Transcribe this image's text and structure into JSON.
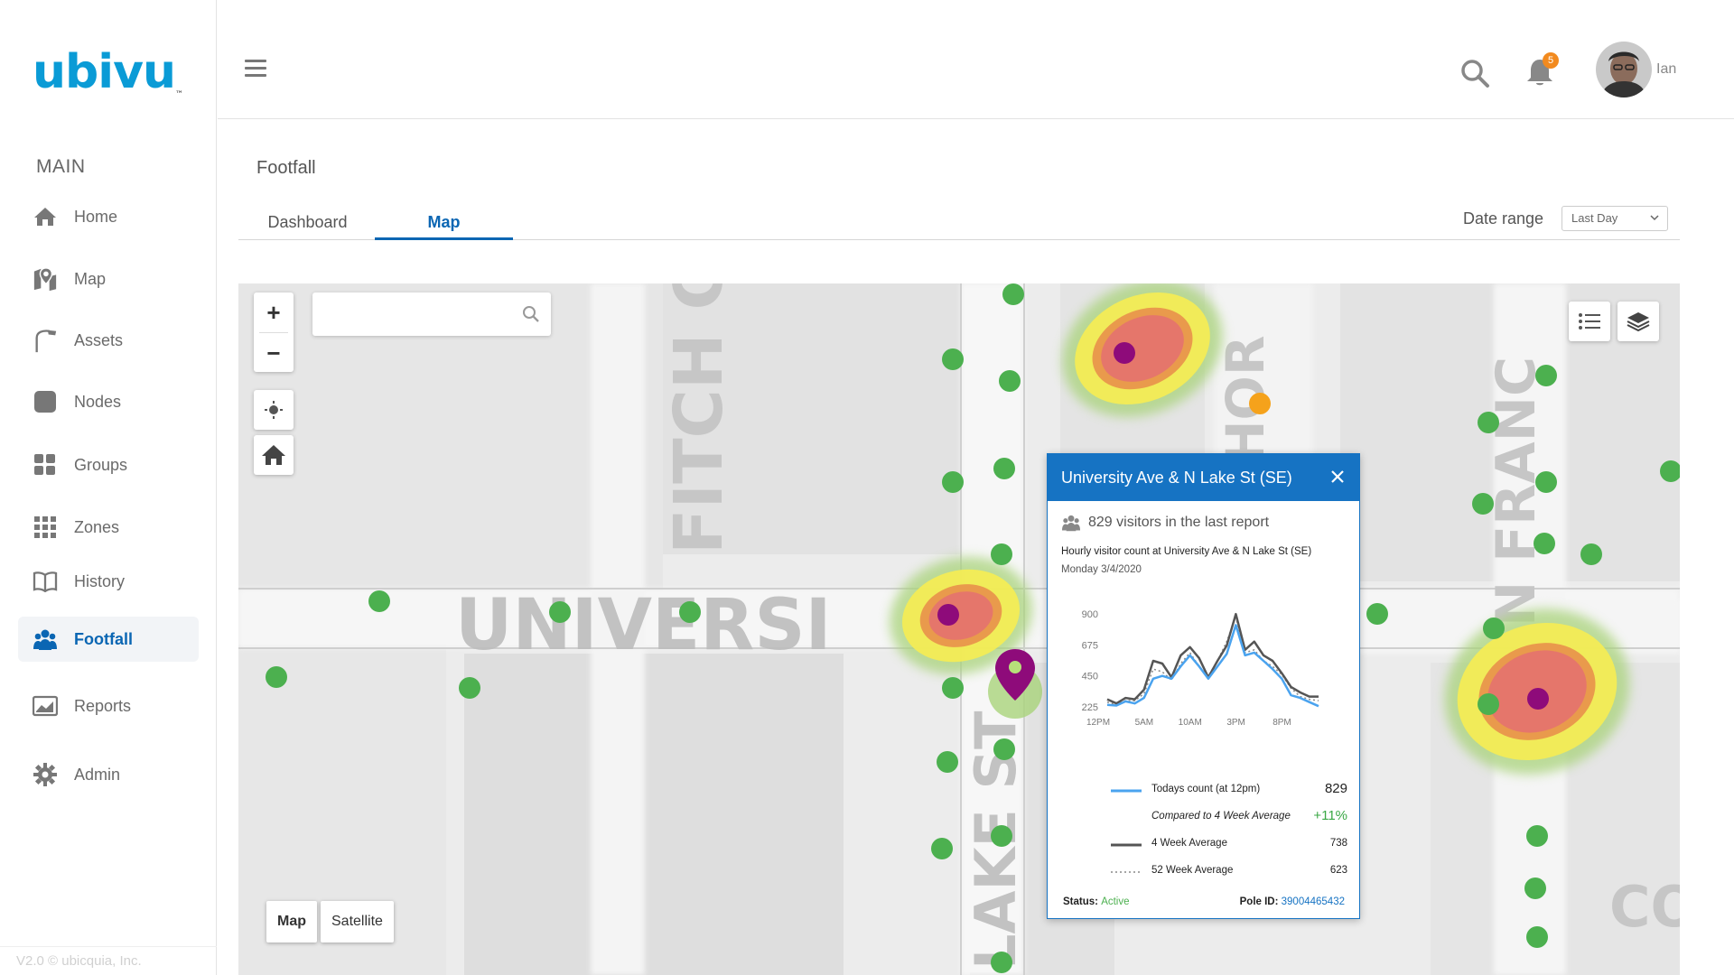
{
  "app": {
    "logo_text": "ubivu",
    "logo_tm": "™",
    "version": "V2.0 © ubicquia, Inc."
  },
  "sidebar": {
    "section_label": "MAIN",
    "items": [
      {
        "label": "Home",
        "icon": "home-icon"
      },
      {
        "label": "Map",
        "icon": "map-pin-icon"
      },
      {
        "label": "Assets",
        "icon": "streetlight-icon"
      },
      {
        "label": "Nodes",
        "icon": "node-icon"
      },
      {
        "label": "Groups",
        "icon": "groups-icon"
      },
      {
        "label": "Zones",
        "icon": "zones-icon"
      },
      {
        "label": "History",
        "icon": "book-icon"
      },
      {
        "label": "Footfall",
        "icon": "people-icon",
        "active": true
      },
      {
        "label": "Reports",
        "icon": "reports-icon"
      },
      {
        "label": "Admin",
        "icon": "gear-icon"
      }
    ]
  },
  "header": {
    "notification_count": "5",
    "user_name": "Ian"
  },
  "page": {
    "title": "Footfall",
    "tabs": [
      {
        "label": "Dashboard",
        "active": false
      },
      {
        "label": "Map",
        "active": true
      }
    ],
    "date_range_label": "Date range",
    "date_range_value": "Last Day"
  },
  "map": {
    "search_placeholder": "",
    "zoom_in": "+",
    "zoom_out": "−",
    "map_type_options": [
      "Map",
      "Satellite"
    ],
    "map_type_selected": "Map",
    "street_labels": [
      "FITCH C",
      "UNIVERSI",
      "LAKE ST",
      "HOR",
      "N FRANC",
      "CO"
    ]
  },
  "popup": {
    "title": "University Ave & N Lake St (SE)",
    "visitors_text": "829 visitors in the last report",
    "chart_subtitle": "Hourly visitor count at University Ave & N Lake St (SE)",
    "chart_date": "Monday 3/4/2020",
    "legend": [
      {
        "label": "Todays count (at 12pm)",
        "value": "829"
      },
      {
        "label": "Compared to 4 Week Average",
        "value": "+11%"
      },
      {
        "label": "4 Week Average",
        "value": "738"
      },
      {
        "label": "52 Week Average",
        "value": "623"
      }
    ],
    "status_label": "Status:",
    "status_value": "Active",
    "pole_label": "Pole ID:",
    "pole_value": "39004465432"
  },
  "colors": {
    "brand": "#0a9bd6",
    "accent": "#0b66b3",
    "popup_header": "#1673c3",
    "node_green": "#4cb04f",
    "node_orange": "#f5a21b",
    "marker_purple": "#8e0b7a",
    "today_series": "#4aa3ef",
    "avg4_series": "#555555",
    "avg52_series": "#888888",
    "positive": "#3aa845"
  },
  "chart_data": {
    "type": "line",
    "title": "Hourly visitor count at University Ave & N Lake St (SE)",
    "subtitle": "Monday 3/4/2020",
    "x_ticks": [
      "12PM",
      "5AM",
      "10AM",
      "3PM",
      "8PM"
    ],
    "y_ticks": [
      225,
      450,
      675,
      900
    ],
    "ylim": [
      225,
      1000
    ],
    "x": [
      "12PM",
      "1AM",
      "2AM",
      "3AM",
      "4AM",
      "5AM",
      "6AM",
      "7AM",
      "8AM",
      "9AM",
      "10AM",
      "11AM",
      "12PM",
      "1PM",
      "2PM",
      "3PM",
      "4PM",
      "5PM",
      "6PM",
      "7PM",
      "8PM",
      "9PM",
      "10PM",
      "11PM"
    ],
    "series": [
      {
        "name": "Todays count (at 12pm)",
        "values": [
          240,
          235,
          265,
          250,
          290,
          430,
          450,
          430,
          520,
          600,
          520,
          430,
          520,
          610,
          820,
          600,
          620,
          560,
          500,
          430,
          310,
          290,
          260,
          230
        ]
      },
      {
        "name": "4 Week Average",
        "values": [
          280,
          250,
          290,
          280,
          350,
          560,
          540,
          440,
          600,
          660,
          580,
          440,
          560,
          670,
          900,
          640,
          700,
          600,
          560,
          470,
          370,
          330,
          300,
          300
        ]
      },
      {
        "name": "52 Week Average",
        "values": [
          260,
          240,
          270,
          270,
          320,
          500,
          480,
          420,
          540,
          620,
          520,
          450,
          560,
          700,
          880,
          620,
          640,
          560,
          520,
          460,
          360,
          300,
          280,
          270
        ]
      }
    ]
  }
}
